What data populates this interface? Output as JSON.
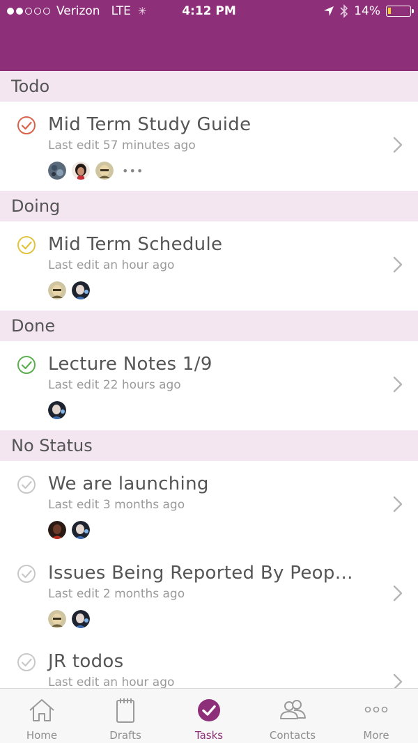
{
  "status_bar": {
    "carrier": "Verizon",
    "network": "LTE",
    "time": "4:12 PM",
    "battery": "14%",
    "battery_level": 0.14
  },
  "sections": {
    "todo": "Todo",
    "doing": "Doing",
    "done": "Done",
    "no_status": "No Status"
  },
  "tasks": [
    {
      "title": "Mid Term Study Guide",
      "subtitle": "Last edit 57 minutes ago",
      "status": "todo",
      "more": "•••"
    },
    {
      "title": "Mid Term Schedule",
      "subtitle": "Last edit an hour ago",
      "status": "doing"
    },
    {
      "title": "Lecture Notes 1/9",
      "subtitle": "Last edit 22 hours ago",
      "status": "done"
    },
    {
      "title": "We are launching",
      "subtitle": "Last edit 3 months ago",
      "status": "none"
    },
    {
      "title": "Issues Being Reported By Peop…",
      "subtitle": "Last edit 2 months ago",
      "status": "none"
    },
    {
      "title": "JR todos",
      "subtitle": "Last edit an hour ago",
      "status": "none"
    }
  ],
  "tabs": [
    {
      "label": "Home",
      "icon": "home-icon"
    },
    {
      "label": "Drafts",
      "icon": "notepad-icon"
    },
    {
      "label": "Tasks",
      "icon": "check-circle-icon",
      "active": true
    },
    {
      "label": "Contacts",
      "icon": "contacts-icon"
    },
    {
      "label": "More",
      "icon": "more-icon"
    }
  ],
  "colors": {
    "brand": "#8e2f79",
    "section_bg": "#f3e6f0",
    "todo": "#d9634a",
    "doing": "#e2c43c",
    "done": "#5bb04e",
    "none": "#c8c8c8"
  }
}
